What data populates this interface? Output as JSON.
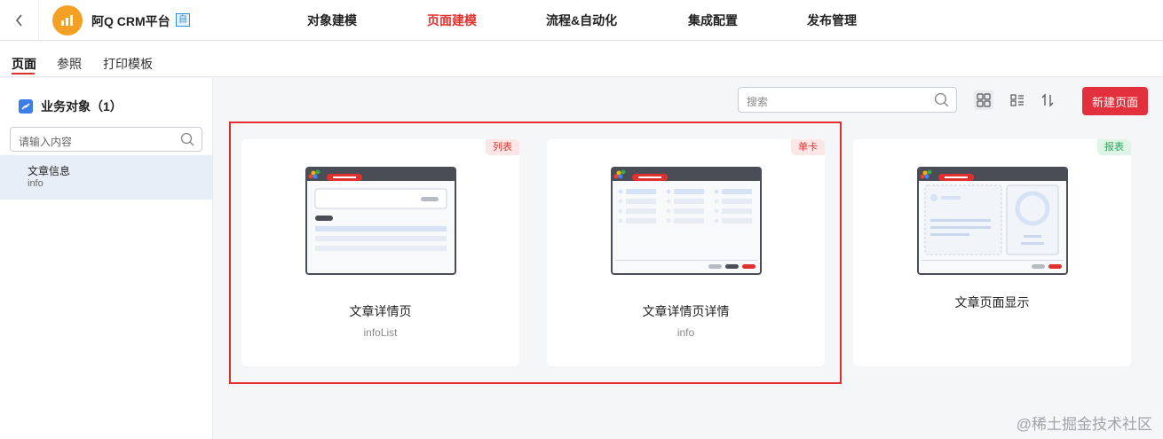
{
  "app": {
    "name": "阿Q CRM平台",
    "badge": "自"
  },
  "nav": [
    "对象建模",
    "页面建模",
    "流程&自动化",
    "集成配置",
    "发布管理"
  ],
  "nav_active": "页面建模",
  "subtabs": [
    "页面",
    "参照",
    "打印模板"
  ],
  "sidebar": {
    "header": "业务对象（1）",
    "search_placeholder": "请输入内容",
    "items": [
      {
        "title": "文章信息",
        "sub": "info"
      }
    ]
  },
  "toolbar": {
    "search_placeholder": "搜索",
    "new_button": "新建页面"
  },
  "cards": [
    {
      "tag": "列表",
      "title": "文章详情页",
      "sub": "infoList"
    },
    {
      "tag": "单卡",
      "title": "文章详情页详情",
      "sub": "info"
    },
    {
      "tag": "报表",
      "title": "文章页面显示",
      "sub": ""
    }
  ],
  "watermark": "@稀土掘金技术社区",
  "colors": {
    "accent": "#e0312f",
    "primary_button": "#e2303d",
    "tag_green": "#31a35a"
  }
}
